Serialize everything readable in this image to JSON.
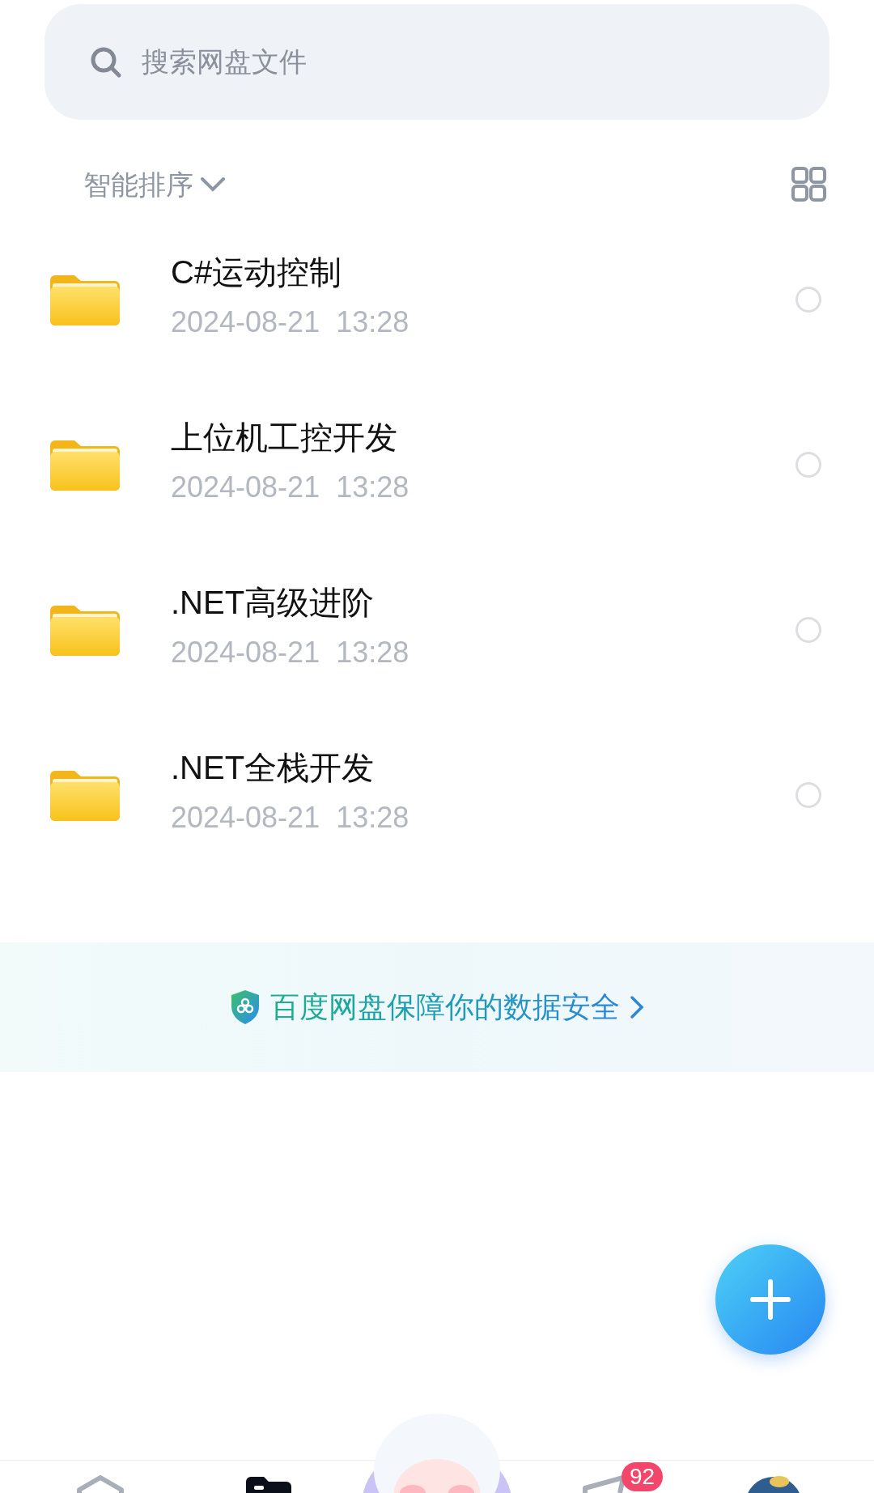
{
  "search": {
    "placeholder": "搜索网盘文件"
  },
  "sort": {
    "label": "智能排序"
  },
  "files": [
    {
      "name": "C#运动控制",
      "date": "2024-08-21  13:28",
      "selected": false
    },
    {
      "name": "上位机工控开发",
      "date": "2024-08-21  13:28",
      "selected": false
    },
    {
      "name": ".NET高级进阶",
      "date": "2024-08-21  13:28",
      "selected": false
    },
    {
      "name": ".NET全栈开发",
      "date": "2024-08-21  13:28",
      "selected": false
    }
  ],
  "banner": {
    "text": "百度网盘保障你的数据安全"
  },
  "tab_bar": [
    {
      "kind": "home",
      "selected": false
    },
    {
      "kind": "files",
      "selected": true
    },
    {
      "kind": "mascot",
      "selected": false
    },
    {
      "kind": "share",
      "selected": false,
      "badge": "92"
    },
    {
      "kind": "profile",
      "selected": false
    }
  ]
}
